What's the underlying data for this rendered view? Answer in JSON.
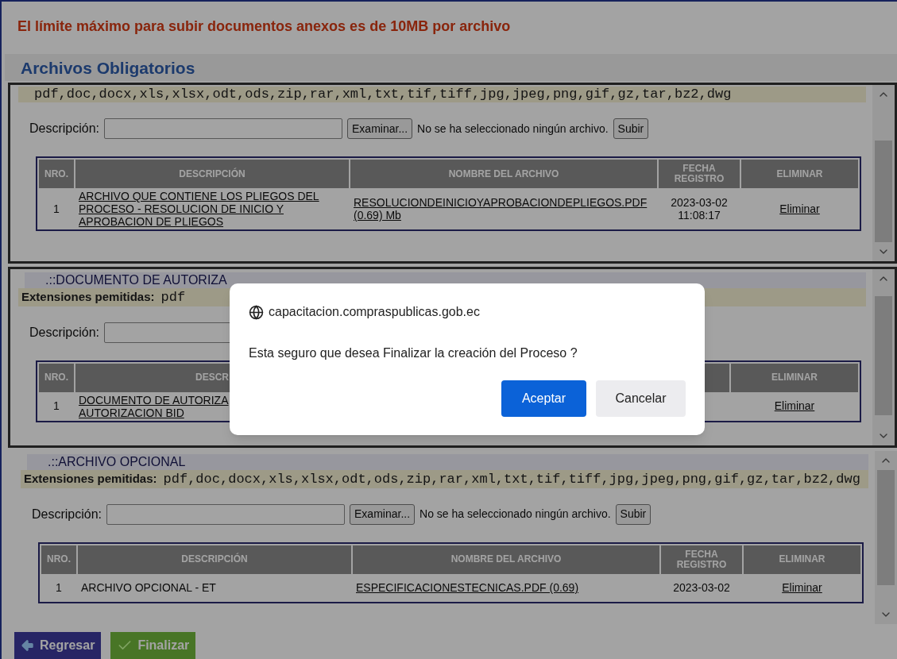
{
  "notice": "El límite máximo para subir documentos anexos es de 10MB por archivo",
  "heading": "Archivos Obligatorios",
  "sections": [
    {
      "extensions": "pdf,doc,docx,xls,xlsx,odt,ods,zip,rar,xml,txt,tif,tiff,jpg,jpeg,png,gif,gz,tar,bz2,dwg",
      "description_label": "Descripción:",
      "browse_button": "Examinar...",
      "no_file": "No se ha seleccionado ningún archivo.",
      "upload_button": "Subir",
      "columns": [
        "NRO.",
        "DESCRIPCIÓN",
        "NOMBRE DEL ARCHIVO",
        "FECHA REGISTRO",
        "ELIMINAR"
      ],
      "rows": [
        {
          "nro": "1",
          "description": "ARCHIVO QUE CONTIENE LOS PLIEGOS DEL PROCESO - RESOLUCION DE INICIO Y APROBACION DE PLIEGOS",
          "file": "RESOLUCIONDEINICIOYAPROBACIONDEPLIEGOS.PDF (0.69) Mb",
          "date": "2023-03-02 11:08:17",
          "delete": "Eliminar"
        }
      ]
    },
    {
      "title": ".::DOCUMENTO DE AUTORIZA",
      "extensions_label": "Extensiones pemitidas:",
      "extensions": "pdf",
      "description_label": "Descripción:",
      "columns": [
        "NRO.",
        "DESCR",
        "ELIMINAR"
      ],
      "rows": [
        {
          "nro": "1",
          "description_lines": [
            "DOCUMENTO DE AUTORIZA",
            "AUTORIZACION BID"
          ],
          "delete": "Eliminar"
        }
      ]
    },
    {
      "title": ".::ARCHIVO OPCIONAL",
      "extensions_label": "Extensiones pemitidas:",
      "extensions": "pdf,doc,docx,xls,xlsx,odt,ods,zip,rar,xml,txt,tif,tiff,jpg,jpeg,png,gif,gz,tar,bz2,dwg",
      "description_label": "Descripción:",
      "browse_button": "Examinar...",
      "no_file": "No se ha seleccionado ningún archivo.",
      "upload_button": "Subir",
      "columns": [
        "NRO.",
        "DESCRIPCIÓN",
        "NOMBRE DEL ARCHIVO",
        "FECHA REGISTRO",
        "ELIMINAR"
      ],
      "rows": [
        {
          "nro": "1",
          "description": "ARCHIVO OPCIONAL - ET",
          "file": "ESPECIFICACIONESTECNICAS.PDF (0.69)",
          "date": "2023-03-02",
          "delete": "Eliminar"
        }
      ]
    }
  ],
  "buttons": [
    {
      "kind": "back",
      "label": "Regresar"
    },
    {
      "kind": "finish",
      "label": "Finalizar"
    }
  ],
  "dialog": {
    "origin": "capacitacion.compraspublicas.gob.ec",
    "message": "Esta seguro que desea Finalizar la creación del Proceso ?",
    "confirm": "Aceptar",
    "cancel": "Cancelar"
  }
}
